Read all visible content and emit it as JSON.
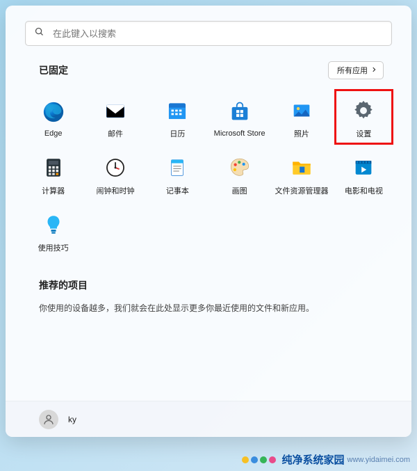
{
  "search": {
    "placeholder": "在此键入以搜索"
  },
  "pinned": {
    "title": "已固定",
    "all_apps_label": "所有应用",
    "apps": [
      {
        "id": "edge",
        "label": "Edge"
      },
      {
        "id": "mail",
        "label": "邮件"
      },
      {
        "id": "calendar",
        "label": "日历"
      },
      {
        "id": "store",
        "label": "Microsoft Store"
      },
      {
        "id": "photos",
        "label": "照片"
      },
      {
        "id": "settings",
        "label": "设置",
        "highlighted": true
      },
      {
        "id": "calculator",
        "label": "计算器"
      },
      {
        "id": "clock",
        "label": "闹钟和时钟"
      },
      {
        "id": "notepad",
        "label": "记事本"
      },
      {
        "id": "paint",
        "label": "画图"
      },
      {
        "id": "explorer",
        "label": "文件资源管理器"
      },
      {
        "id": "movies",
        "label": "电影和电视"
      },
      {
        "id": "tips",
        "label": "使用技巧"
      }
    ]
  },
  "recommended": {
    "title": "推荐的项目",
    "empty_text": "你使用的设备越多，我们就会在此处显示更多你最近使用的文件和新应用。"
  },
  "user": {
    "name": "ky"
  },
  "watermark": {
    "brand": "纯净系统家园",
    "url": "www.yidaimei.com"
  },
  "colors": {
    "highlight_border": "#e11",
    "accent_blue": "#0078d4"
  }
}
